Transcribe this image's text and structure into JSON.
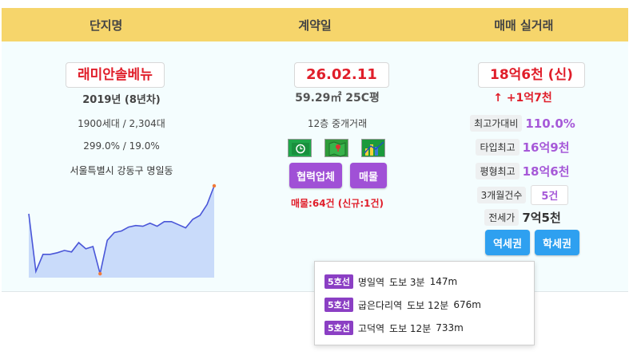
{
  "header": {
    "col1": "단지명",
    "col2": "계약일",
    "col3": "매매 실거래"
  },
  "complex": {
    "name": "래미안솔베뉴",
    "year": "2019년 (8년차)",
    "units": "1900세대 / 2,304대",
    "ratio": "299.0% / 19.0%",
    "address": "서울특별시 강동구 명일동"
  },
  "contract": {
    "date": "26.02.11",
    "area": "59.29㎡ 25C평",
    "floor_type": "12층 중개거래",
    "icons": [
      "clock-icon",
      "map-icon",
      "chart-icon"
    ],
    "partner_button": "협력업체",
    "listing_button": "매물",
    "listing_count": "매물:64건 (신규:1건)"
  },
  "trade": {
    "price": "18억6천 (신)",
    "change": "↑ +1억7천",
    "stats": [
      {
        "label": "최고가대비",
        "value": "110.0%"
      },
      {
        "label": "타입최고",
        "value": "16억9천"
      },
      {
        "label": "평형최고",
        "value": "18억6천"
      }
    ],
    "count_label": "3개월건수",
    "count_value": "5건",
    "jeonse_label": "전세가",
    "jeonse_value": "7억5천",
    "station_button": "역세권",
    "school_button": "학세권"
  },
  "stations": [
    {
      "line": "5호선",
      "name": "명일역",
      "walk": "도보 3분",
      "dist": "147m"
    },
    {
      "line": "5호선",
      "name": "굽은다리역",
      "walk": "도보 12분",
      "dist": "676m"
    },
    {
      "line": "5호선",
      "name": "고덕역",
      "walk": "도보 12분",
      "dist": "733m"
    }
  ],
  "colors": {
    "header": "#f6d56b",
    "accent_red": "#e01e2a",
    "accent_purple": "#a050d6",
    "accent_blue": "#2ea0f0",
    "line5": "#8b3fc4"
  },
  "chart_data": {
    "type": "area",
    "values": [
      82,
      8,
      30,
      30,
      32,
      35,
      33,
      45,
      37,
      40,
      5,
      48,
      58,
      60,
      65,
      67,
      66,
      70,
      66,
      72,
      72,
      68,
      64,
      75,
      80,
      94,
      118
    ],
    "ylim": [
      0,
      120
    ],
    "xlabel": "",
    "ylabel": ""
  }
}
